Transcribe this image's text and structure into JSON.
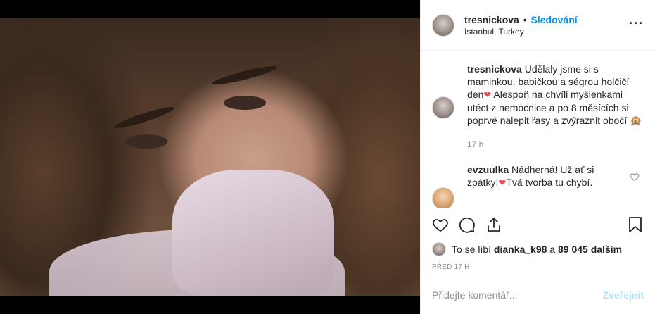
{
  "header": {
    "username": "tresnickova",
    "separator": "•",
    "follow_label": "Sledování",
    "location": "Istanbul, Turkey",
    "more_icon": "more-horizontal-icon"
  },
  "caption": {
    "username": "tresnickova",
    "text_part1": "Udělaly jsme si s maminkou, babičkou a ségrou holčičí den",
    "heart": "❤",
    "text_part2": " Alespoň na chvíli myšlenkami utéct z nemocnice a po 8 měsících si poprvé nalepit řasy a zvýraznit obočí ",
    "emoji": "🙊",
    "time": "17 h"
  },
  "comment": {
    "username": "evzuulka",
    "text_part1": "Nádherná! Už ať si zpátky!",
    "heart": "❤",
    "text_part2": "Tvá tvorba tu chybí."
  },
  "likes": {
    "prefix": "To se líbí",
    "user": "dianka_k98",
    "connector": "a",
    "count_text": "89 045 dalším"
  },
  "posted_ago": "PŘED 17 H",
  "add_comment": {
    "placeholder": "Přidejte komentář...",
    "post_label": "Zveřejnit"
  },
  "colors": {
    "accent": "#0095f6",
    "post_disabled": "#b2dffc",
    "muted": "#8e8e8e",
    "heart": "#ed4956"
  }
}
